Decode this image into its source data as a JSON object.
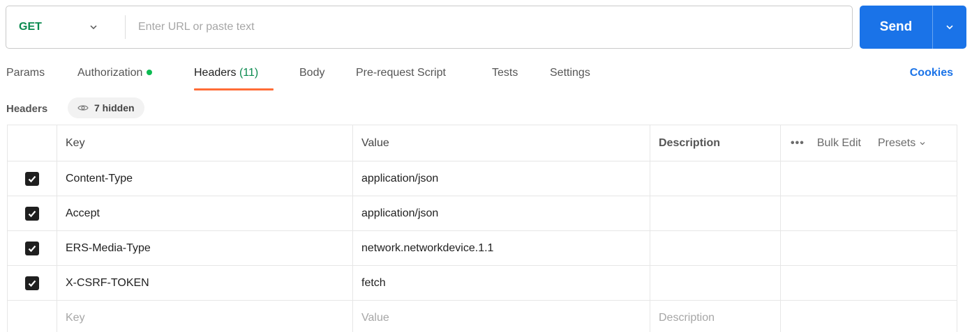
{
  "request": {
    "method": "GET",
    "url_value": "",
    "url_placeholder": "Enter URL or paste text",
    "send_label": "Send"
  },
  "tabs": [
    {
      "label": "Params"
    },
    {
      "label": "Authorization"
    },
    {
      "label": "Headers",
      "count": "(11)"
    },
    {
      "label": "Body"
    },
    {
      "label": "Pre-request Script"
    },
    {
      "label": "Tests"
    },
    {
      "label": "Settings"
    }
  ],
  "cookies_label": "Cookies",
  "headers_section": {
    "title": "Headers",
    "hidden_label": "7 hidden"
  },
  "table": {
    "columns": {
      "key": "Key",
      "value": "Value",
      "description": "Description"
    },
    "actions": {
      "more": "•••",
      "bulk_edit": "Bulk Edit",
      "presets": "Presets"
    },
    "rows": [
      {
        "key": "Content-Type",
        "value": "application/json",
        "description": ""
      },
      {
        "key": "Accept",
        "value": "application/json",
        "description": ""
      },
      {
        "key": "ERS-Media-Type",
        "value": "network.networkdevice.1.1",
        "description": ""
      },
      {
        "key": "X-CSRF-TOKEN",
        "value": "fetch",
        "description": ""
      }
    ],
    "new_row": {
      "key_placeholder": "Key",
      "value_placeholder": "Value",
      "description_placeholder": "Description"
    }
  },
  "colors": {
    "method_get": "#0b8a4f",
    "send_button": "#1a73e8",
    "active_tab_underline": "#ff6c37",
    "auth_dot": "#0cbb52",
    "link": "#1a73e8"
  }
}
